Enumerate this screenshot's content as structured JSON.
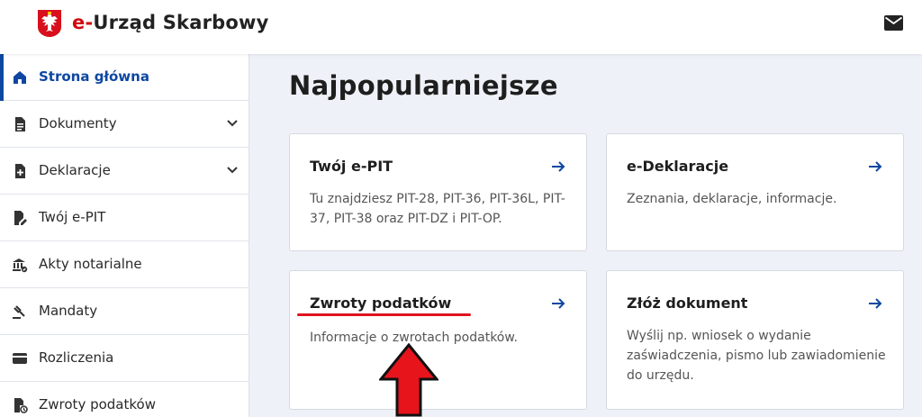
{
  "header": {
    "brand_prefix": "e-",
    "brand_name": "Urząd Skarbowy",
    "icons": {
      "emblem": "polish-eagle-emblem",
      "mail": "mail-icon"
    },
    "colors": {
      "accent": "#d10a11"
    }
  },
  "sidebar": {
    "items": [
      {
        "label": "Strona główna",
        "icon": "home-icon",
        "active": true,
        "expandable": false
      },
      {
        "label": "Dokumenty",
        "icon": "document-icon",
        "active": false,
        "expandable": true
      },
      {
        "label": "Deklaracje",
        "icon": "declaration-icon",
        "active": false,
        "expandable": true
      },
      {
        "label": "Twój e-PIT",
        "icon": "edit-document-icon",
        "active": false,
        "expandable": false
      },
      {
        "label": "Akty notarialne",
        "icon": "bank-icon",
        "active": false,
        "expandable": false
      },
      {
        "label": "Mandaty",
        "icon": "gavel-icon",
        "active": false,
        "expandable": false
      },
      {
        "label": "Rozliczenia",
        "icon": "wallet-icon",
        "active": false,
        "expandable": false
      },
      {
        "label": "Zwroty podatków",
        "icon": "refund-icon",
        "active": false,
        "expandable": false
      }
    ],
    "colors": {
      "active": "#0d47a1"
    }
  },
  "main": {
    "title": "Najpopularniejsze",
    "cards": [
      {
        "title": "Twój e-PIT",
        "desc": "Tu znajdziesz PIT-28, PIT-36, PIT-36L, PIT-37, PIT-38 oraz PIT-DZ i PIT-OP."
      },
      {
        "title": "e-Deklaracje",
        "desc": "Zeznania, deklaracje, informacje."
      },
      {
        "title": "Zwroty podatków",
        "desc": "Informacje o zwrotach podatków."
      },
      {
        "title": "Złóż dokument",
        "desc": "Wyślij np. wniosek o wydanie zaświadczenia, pismo lub zawiadomienie do urzędu."
      }
    ]
  },
  "annotation": {
    "highlight_color": "#e0131f",
    "pointer": "red-up-arrow"
  }
}
